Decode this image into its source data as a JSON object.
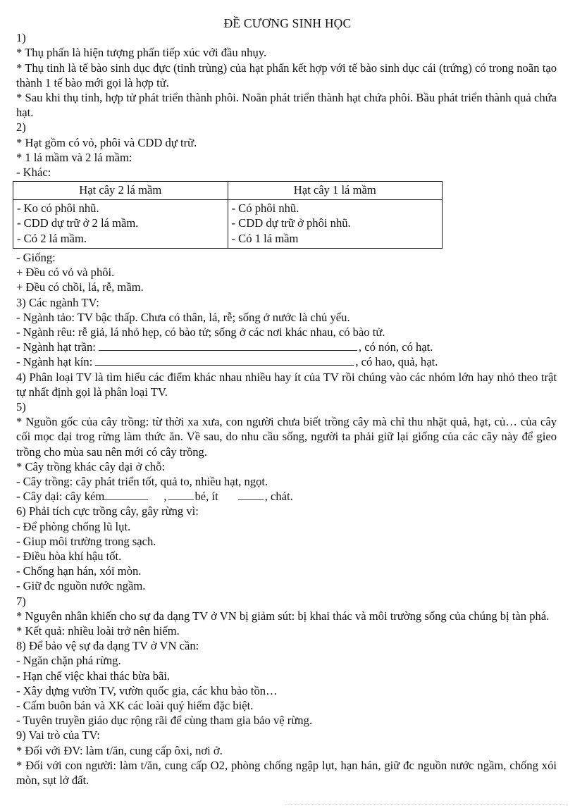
{
  "document": {
    "title": "ĐỀ CƯƠNG SINH HỌC",
    "sections": {
      "s1": {
        "number": "1)",
        "l1": "* Thụ phấn là hiện tượng phấn tiếp xúc với đầu nhụy.",
        "l2": "* Thụ tinh là tế bào sinh dục đực (tinh trùng) của hạt phấn kết hợp với tế bào sinh dục cái (trứng) có trong noãn tạo thành 1 tế bào mới gọi là hợp tử.",
        "l3": "* Sau khi thụ tinh, hợp tử phát triển thành phôi. Noãn phát triển thành hạt chứa phôi. Bầu phát triển thành quả chứa hạt."
      },
      "s2": {
        "number": "2)",
        "l1": "* Hạt gồm có vỏ, phôi và CDD dự trữ.",
        "l2": "* 1 lá mầm và 2 lá mầm:",
        "l3": "- Khác:",
        "table": {
          "headers": [
            "Hạt cây 2 lá mầm",
            "Hạt cây 1 lá mầm"
          ],
          "col1": [
            "- Ko có phôi nhũ.",
            "- CDD dự trữ ở 2 lá mầm.",
            "- Có 2 lá mầm."
          ],
          "col2": [
            "- Có phôi nhũ.",
            "- CDD dự trữ ở phôi nhũ.",
            "- Có 1 lá mầm"
          ]
        },
        "l4": "- Giống:",
        "l5": "+ Đều có vỏ và phôi.",
        "l6": "+ Đều có chồi, lá, rễ, mầm."
      },
      "s3": {
        "heading": "3) Các ngành TV:",
        "l1": "- Ngành tảo: TV bậc thấp. Chưa có thân, lá, rễ; sống ở nước là chủ yếu.",
        "l2": "- Ngành rêu:  rễ giả, lá nhỏ hẹp, có bào tử; sống ở các nơi khác nhau, có bào tử.",
        "l3_pre": "- Ngành hạt trần:",
        "l3_post": ", có nón, có hạt.",
        "l4_pre": "- Ngành hạt kín:",
        "l4_post": ", có hao, quả, hạt."
      },
      "s4": {
        "text": "4) Phân loại TV là tìm hiểu các điểm khác nhau nhiều hay ít của TV rồi chúng vào các nhóm lớn hay nhỏ theo trật tự nhất định gọi là phân loại TV."
      },
      "s5": {
        "number": "5)",
        "l1": "* Nguồn gốc của cây trồng: từ thời xa xưa, con người chưa biết trồng cây mà chỉ thu nhặt quả, hạt, củ… của cây cối mọc dại trog rừng làm thức ăn. Về sau, do nhu cầu sống, người ta phải giữ lại giống của các cây này để gieo trồng cho mùa sau nên mới có cây trồng.",
        "l2": "* Cây trồng khác cây dại ở chỗ:",
        "l3": "- Cây trồng: cây phát triển tốt, quả to, nhiều hạt, ngọt.",
        "l4_a": "- Cây dại: cây kém",
        "l4_b": ",",
        "l4_c": "bé, ít",
        "l4_d": ", chát."
      },
      "s6": {
        "heading": "6) Phải tích cực trồng cây, gây rừng vì:",
        "items": [
          "- Để phòng chống lũ lụt.",
          "- Giup môi trường trong sạch.",
          "- Điều hòa khí hậu tốt.",
          "- Chống hạn hán, xói mòn.",
          "- Giữ đc nguồn nước ngầm."
        ]
      },
      "s7": {
        "number": "7)",
        "l1": "* Nguyên nhân khiến cho sự đa dạng TV ở VN bị giảm sút: bị khai thác và môi trường sống của chúng bị tàn phá.",
        "l2": "* Kết quả: nhiều loài trở nên hiếm."
      },
      "s8": {
        "heading": "8) Để bảo vệ sự đa dạng TV ở VN cần:",
        "items": [
          "- Ngăn chặn phá rừng.",
          "- Hạn chế việc khai thác bừa bãi.",
          "- Xây dựng vườn TV, vườn quốc gia, các khu bảo tồn…",
          "- Cấm buôn bán và XK các loài  quý hiếm đặc biệt.",
          "- Tuyên truyền giáo  dục rộng rãi để cùng tham gia bảo vệ rừng."
        ]
      },
      "s9": {
        "heading": "9) Vai trò của TV:",
        "l1": "* Đối với ĐV: làm t/ăn, cung cấp ôxi, nơi ở.",
        "l2": "* Đối với con người: làm t/ăn, cung cấp O2, phòng chống ngập lụt, hạn hán, giữ đc nguồn nước ngầm, chống xói mòn, sụt lở đất."
      }
    }
  },
  "colors": {
    "text": "#111111",
    "rule": "#1a1a1a",
    "blank_rule": "#2a2a2a",
    "bottom_dots": "#f6b8d8"
  }
}
